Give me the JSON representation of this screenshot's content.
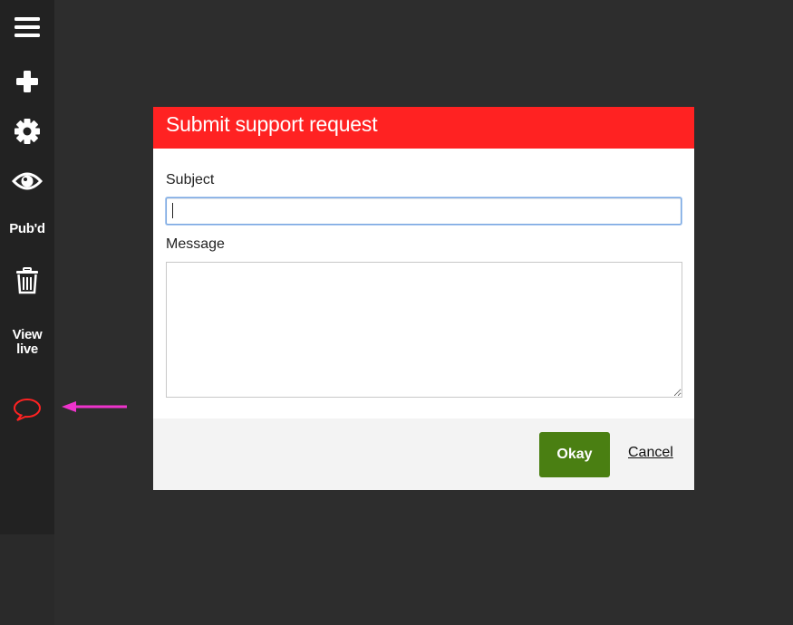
{
  "sidebar": {
    "items": [
      {
        "icon": "hamburger-menu-icon"
      },
      {
        "icon": "plus-icon"
      },
      {
        "icon": "gear-icon"
      },
      {
        "icon": "eye-icon"
      },
      {
        "label": "Pub'd"
      },
      {
        "icon": "trash-icon"
      },
      {
        "label_line1": "View",
        "label_line2": "live"
      },
      {
        "icon": "speech-bubble-icon",
        "color": "#ff2222"
      }
    ],
    "arrow_color": "#ee33cc"
  },
  "dialog": {
    "title": "Submit support request",
    "subject_label": "Subject",
    "subject_value": "",
    "message_label": "Message",
    "message_value": "",
    "okay_label": "Okay",
    "cancel_label": "Cancel",
    "header_color": "#ff2222",
    "okay_color": "#4a7f12"
  }
}
